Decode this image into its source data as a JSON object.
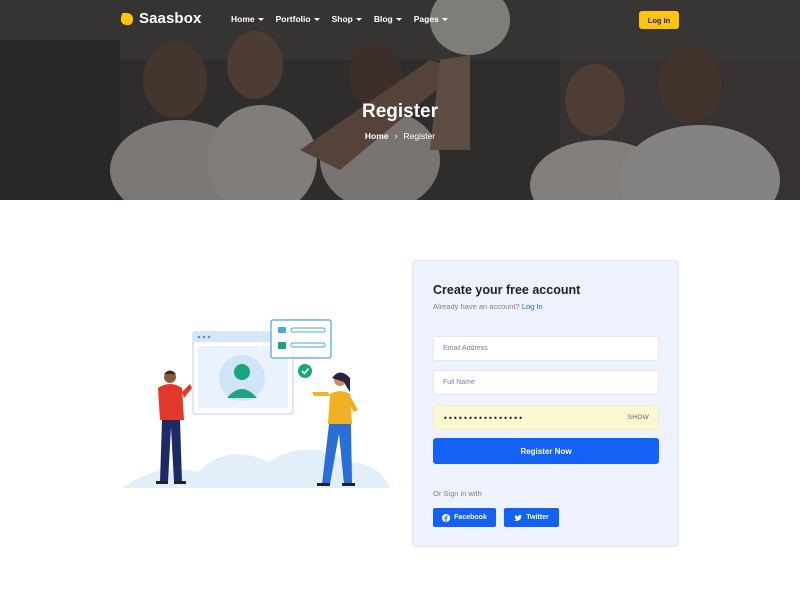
{
  "brand": {
    "name": "Saasbox",
    "accent": "#ffc40d",
    "primary": "#1461f5"
  },
  "nav": {
    "items": [
      {
        "label": "Home"
      },
      {
        "label": "Portfolio"
      },
      {
        "label": "Shop"
      },
      {
        "label": "Blog"
      },
      {
        "label": "Pages"
      }
    ],
    "login_label": "Log In"
  },
  "hero": {
    "title": "Register",
    "breadcrumb": {
      "home": "Home",
      "current": "Register"
    }
  },
  "form": {
    "title": "Create your free account",
    "subtitle": "Already have an account?",
    "login_link": "Log In",
    "email_placeholder": "Email Address",
    "name_placeholder": "Full Name",
    "password_value": "••••••••••••••••",
    "show_label": "SHOW",
    "submit_label": "Register Now",
    "or_text": "Or Sign in with",
    "social": [
      {
        "label": "Facebook",
        "icon": "facebook-icon"
      },
      {
        "label": "Twitter",
        "icon": "twitter-icon"
      }
    ]
  }
}
